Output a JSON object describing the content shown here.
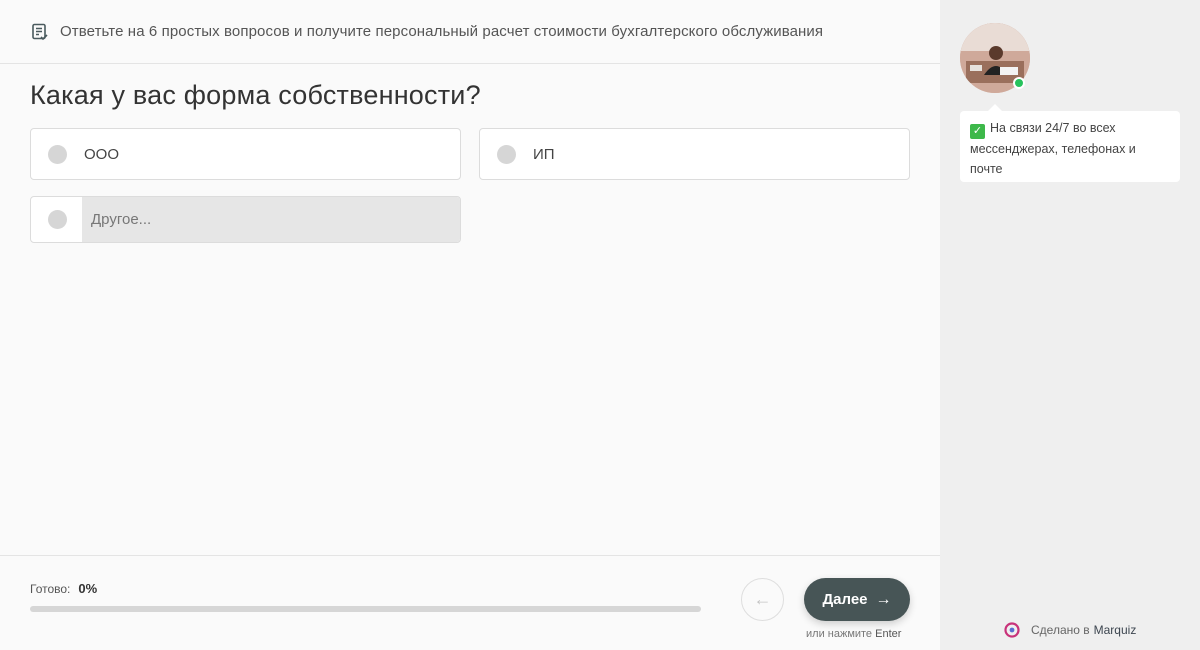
{
  "header": {
    "intro_text": "Ответьте на 6 простых вопросов и получите персональный расчет стоимости бухгалтерского обслуживания",
    "icon": "form-icon"
  },
  "question": {
    "title": "Какая у вас форма собственности?",
    "options": [
      {
        "label": "ООО",
        "selected": false
      },
      {
        "label": "ИП",
        "selected": false
      }
    ],
    "other": {
      "placeholder": "Другое...",
      "value": ""
    }
  },
  "footer": {
    "progress_label": "Готово:",
    "progress_value": "0%",
    "progress_fraction": 0,
    "next_label": "Далее",
    "hint_prefix": "или нажмите",
    "hint_key": "Enter"
  },
  "sidebar": {
    "status": "online",
    "message": "На связи 24/7 во всех мессенджерах, телефонах и почте"
  },
  "made_by": {
    "prefix": "Сделано в",
    "brand": "Marquiz"
  },
  "colors": {
    "accent": "#475556",
    "online": "#27c25c",
    "check": "#3db84a"
  }
}
